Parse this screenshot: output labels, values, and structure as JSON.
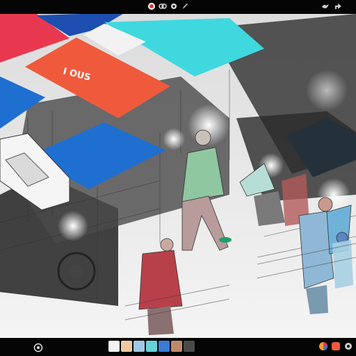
{
  "topbar": {
    "title": "",
    "icons": [
      "record-icon",
      "link-icon",
      "gear-icon",
      "pencil-icon"
    ],
    "right_icons": [
      "bird-icon",
      "share-icon"
    ]
  },
  "canvas": {
    "sign_text": "I OUS"
  },
  "bottombar": {
    "title": "",
    "label": "",
    "status": "",
    "thumbnail_colors": [
      "#f2f2f2",
      "#f0c8a0",
      "#9fc7e6",
      "#6ad0d8",
      "#3a7bd5",
      "#c08a6a",
      "#4a4a4a"
    ]
  },
  "colors": {
    "awning_cyan": "#3fd8df",
    "awning_orange": "#ef5a3c",
    "awning_blue": "#1f6fd1",
    "awning_red": "#e8384f",
    "awning_darkblue": "#1d4fb0"
  }
}
